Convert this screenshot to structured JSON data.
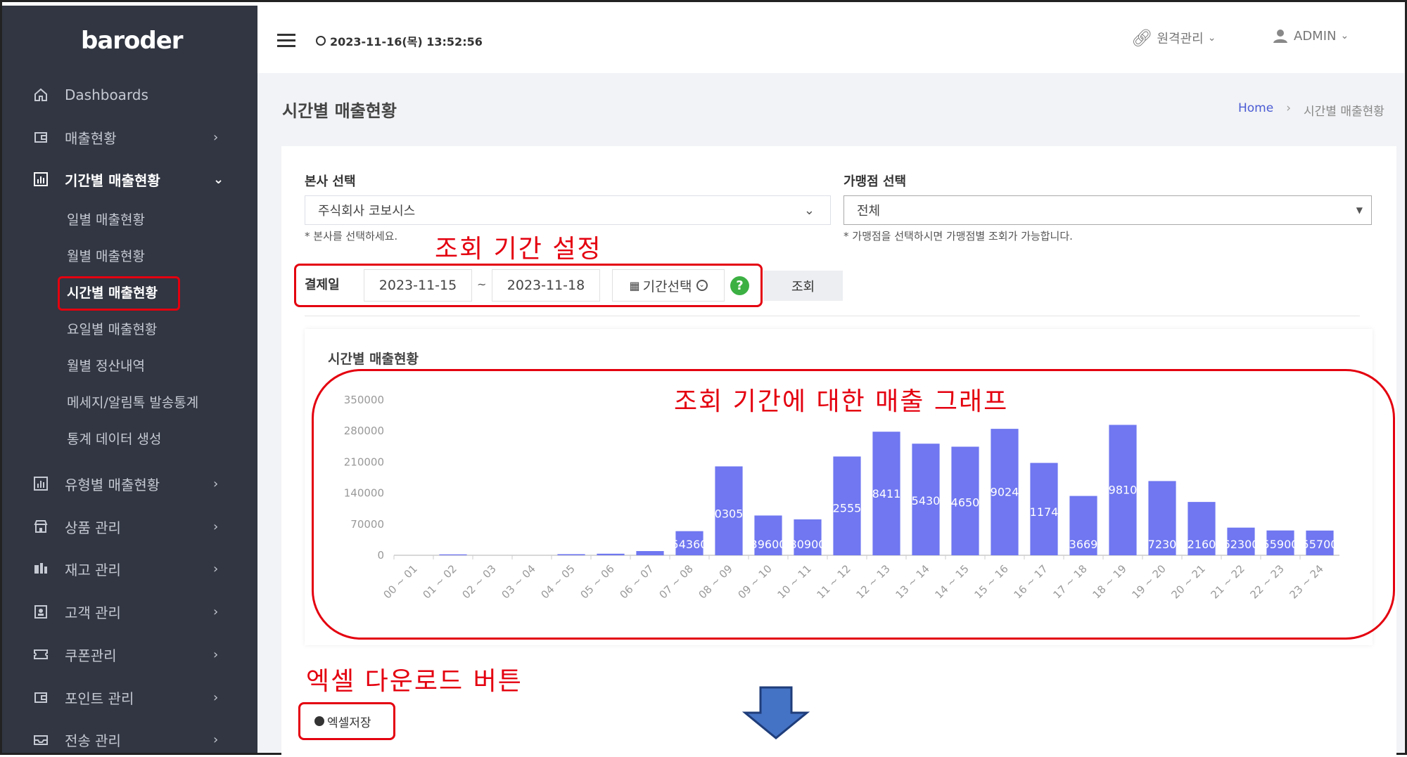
{
  "app": {
    "logo": "baroder"
  },
  "header": {
    "datetime": "2023-11-16(목) 13:52:56",
    "remote_label": "원격관리",
    "user_label": "ADMIN"
  },
  "sidebar": {
    "items": [
      {
        "label": "Dashboards"
      },
      {
        "label": "매출현황"
      },
      {
        "label": "기간별 매출현황"
      },
      {
        "label": "유형별 매출현황"
      },
      {
        "label": "상품 관리"
      },
      {
        "label": "재고 관리"
      },
      {
        "label": "고객 관리"
      },
      {
        "label": "쿠폰관리"
      },
      {
        "label": "포인트 관리"
      },
      {
        "label": "전송 관리"
      }
    ],
    "sub_items": [
      {
        "label": "일별 매출현황"
      },
      {
        "label": "월별 매출현황"
      },
      {
        "label": "시간별 매출현황"
      },
      {
        "label": "요일별 매출현황"
      },
      {
        "label": "월별 정산내역"
      },
      {
        "label": "메세지/알림톡 발송통계"
      },
      {
        "label": "통계 데이터 생성"
      }
    ]
  },
  "page": {
    "title": "시간별 매출현황",
    "breadcrumb_home": "Home",
    "breadcrumb_current": "시간별 매출현황"
  },
  "filters": {
    "hq_label": "본사 선택",
    "hq_value": "주식회사 코보시스",
    "hq_hint": "* 본사를 선택하세요.",
    "store_label": "가맹점 선택",
    "store_value": "전체",
    "store_hint": "* 가맹점을 선택하시면 가맹점별 조회가 가능합니다.",
    "date_label": "결제일",
    "date_from": "2023-11-15",
    "date_sep": "~",
    "date_to": "2023-11-18",
    "period_button": "기간선택",
    "help": "?",
    "search_button": "조회"
  },
  "annotations": {
    "period_setting": "조회 기간 설정",
    "graph": "조회 기간에 대한 매출 그래프",
    "excel": "엑셀 다운로드 버튼"
  },
  "excel_button": "엑셀저장",
  "colors": {
    "bar": "#7077f0",
    "annotation": "#e4000f",
    "sidebar": "#313642",
    "arrow": "#4472c4"
  },
  "chart_data": {
    "type": "bar",
    "title": "시간별 매출현황",
    "categories": [
      "00 ~ 01",
      "01 ~ 02",
      "02 ~ 03",
      "03 ~ 04",
      "04 ~ 05",
      "05 ~ 06",
      "06 ~ 07",
      "07 ~ 08",
      "08 ~ 09",
      "09 ~ 10",
      "10 ~ 11",
      "11 ~ 12",
      "12 ~ 13",
      "13 ~ 14",
      "14 ~ 15",
      "15 ~ 16",
      "16 ~ 17",
      "17 ~ 18",
      "18 ~ 19",
      "19 ~ 20",
      "20 ~ 21",
      "21 ~ 22",
      "22 ~ 23",
      "23 ~ 24"
    ],
    "values": [
      0,
      2000,
      0,
      0,
      2500,
      3500,
      9500,
      54360,
      200305,
      89600,
      80900,
      222555,
      278411,
      251430,
      244650,
      284902,
      208117,
      133669,
      293810,
      167230,
      120160,
      62300,
      55900,
      55700
    ],
    "labels": [
      "",
      "",
      "",
      "",
      "",
      "",
      "",
      "54360",
      "0305",
      "39600",
      "80900",
      "2555",
      "8411",
      "5430",
      "4650",
      "9024",
      "1174",
      "3669",
      "9810",
      "7230",
      "2160",
      "62300",
      "55900",
      "55700"
    ],
    "yticks": [
      "350000",
      "280000",
      "210000",
      "140000",
      "70000",
      "0"
    ],
    "ylim": [
      0,
      350000
    ],
    "grid": false,
    "legend": "none"
  }
}
